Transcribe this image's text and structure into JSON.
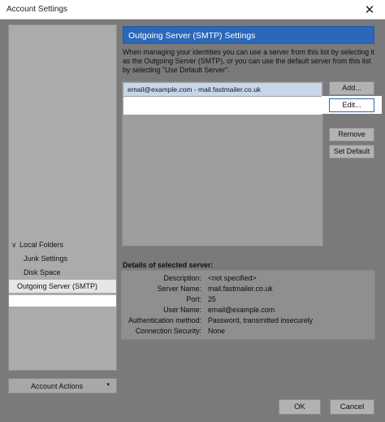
{
  "window": {
    "title": "Account Settings",
    "close_glyph": "✕"
  },
  "sidebar": {
    "items": [
      {
        "label": "Local Folders",
        "expanded": true
      },
      {
        "label": "Junk Settings"
      },
      {
        "label": "Disk Space"
      },
      {
        "label": "Outgoing Server (SMTP)",
        "selected": true
      }
    ],
    "chevron_glyph": "∨",
    "account_actions": {
      "label": "Account Actions",
      "arrow_glyph": "▾"
    }
  },
  "main": {
    "heading": "Outgoing Server (SMTP) Settings",
    "intro": "When managing your identities you can use a server from this list by selecting it as the Outgoing Server (SMTP), or you can use the default server from this list by selecting \"Use Default Server\".",
    "servers": [
      {
        "label": "email@example.com - mail.fastmailer.co.uk"
      }
    ],
    "buttons": {
      "add": "Add...",
      "edit": "Edit...",
      "remove": "Remove",
      "set_default": "Set Default"
    },
    "details": {
      "title": "Details of selected server:",
      "rows": [
        {
          "key": "Description:",
          "value": "<not specified>"
        },
        {
          "key": "Server Name:",
          "value": "mail.fastmailer.co.uk"
        },
        {
          "key": "Port:",
          "value": "25"
        },
        {
          "key": "User Name:",
          "value": "email@example.com"
        },
        {
          "key": "Authentication method:",
          "value": "Password, transmitted insecurely"
        },
        {
          "key": "Connection Security:",
          "value": "None"
        }
      ]
    }
  },
  "footer": {
    "ok": "OK",
    "cancel": "Cancel"
  },
  "colors": {
    "accent": "#2c67b8",
    "selected_row": "#c9d7ea"
  }
}
